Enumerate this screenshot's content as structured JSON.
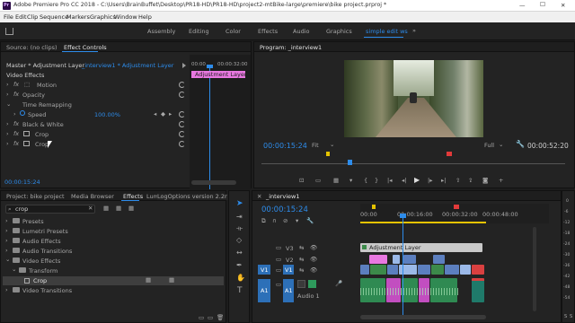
{
  "window": {
    "title": "Adobe Premiere Pro CC 2018 - C:\\Users\\BrainBuffet\\Desktop\\PR18-HD\\PR18-HD\\project2-mtBike-large\\premiere\\bike project.prproj *",
    "minimize": "—",
    "maximize": "☐",
    "close": "✕"
  },
  "menu": [
    "File",
    "Edit",
    "Clip",
    "Sequence",
    "Markers",
    "Graphics",
    "Window",
    "Help"
  ],
  "workspaces": [
    "Assembly",
    "Editing",
    "Color",
    "Effects",
    "Audio",
    "Graphics",
    "simple edit ws"
  ],
  "workspace_more": "»",
  "effect_controls": {
    "tab_source": "Source: (no clips)",
    "tab_active": "Effect Controls",
    "master_label": "Master * Adjustment Layer",
    "seq_label": "_interview1 * Adjustment Layer",
    "ruler_start": "00:00",
    "ruler_end": "00:00:32:00",
    "clip_label": "Adjustment Layer",
    "section": "Video Effects",
    "rows": [
      {
        "fx": "fx",
        "name": "Motion"
      },
      {
        "fx": "fx",
        "name": "Opacity"
      },
      {
        "fx": "",
        "name": "Time Remapping"
      },
      {
        "fx": "",
        "name": "Speed",
        "value": "100.00%"
      },
      {
        "fx": "fx",
        "name": "Black & White"
      },
      {
        "fx": "fx",
        "name": "Crop"
      },
      {
        "fx": "fx",
        "name": "Crop"
      }
    ],
    "timecode": "00:00:15:24"
  },
  "program": {
    "tab": "Program: _interview1",
    "timecode": "00:00:15:24",
    "fit": "Fit",
    "quality": "Full",
    "duration": "00:00:52:20"
  },
  "project": {
    "tabs": [
      "Project: bike project",
      "Media Browser",
      "Effects",
      "Lumetri Color",
      "LogOptions version 2.2r"
    ],
    "search_value": "crop",
    "tree": [
      {
        "label": "Presets",
        "indent": 0
      },
      {
        "label": "Lumetri Presets",
        "indent": 0
      },
      {
        "label": "Audio Effects",
        "indent": 0
      },
      {
        "label": "Audio Transitions",
        "indent": 0
      },
      {
        "label": "Video Effects",
        "indent": 0
      },
      {
        "label": "Transform",
        "indent": 1
      },
      {
        "label": "Crop",
        "indent": 2
      },
      {
        "label": "Video Transitions",
        "indent": 0
      }
    ]
  },
  "timeline": {
    "tab": "_interview1",
    "timecode": "00:00:15:24",
    "ruler": [
      "00:00",
      "00:00:16:00",
      "00:00:32:00",
      "00:00:48:00"
    ],
    "tracks": [
      {
        "id": "V3",
        "src": ""
      },
      {
        "id": "V2",
        "src": ""
      },
      {
        "id": "V1",
        "src": "V1"
      },
      {
        "id": "A1",
        "src": "A1"
      }
    ],
    "adjustment_layer": "Adjustment Layer",
    "audio_label": "Audio 1",
    "meter_labels": [
      "0",
      "-6",
      "-12",
      "-18",
      "-24",
      "-30",
      "-36",
      "-42",
      "-48",
      "-54"
    ],
    "meter_foot": [
      "S",
      "S"
    ]
  },
  "colors": {
    "accent": "#2d8ceb",
    "adjust": "#e878e0",
    "clip_blue": "#5c7fbf",
    "clip_green": "#3c8a4a",
    "audio_green": "#2f8a52"
  }
}
